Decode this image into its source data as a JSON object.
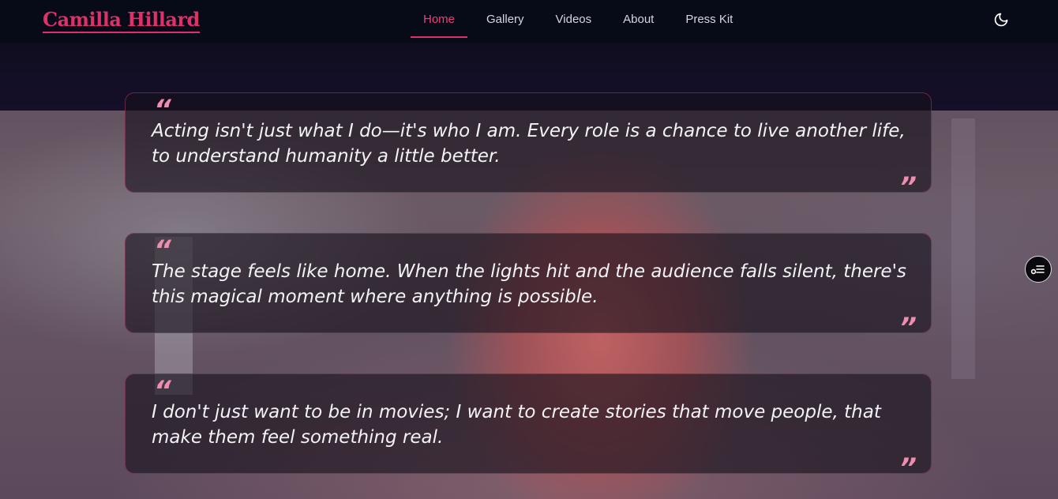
{
  "brand": {
    "name": "Camilla Hillard",
    "color": "#e0306a"
  },
  "nav": {
    "items": [
      {
        "label": "Home",
        "active": true
      },
      {
        "label": "Gallery",
        "active": false
      },
      {
        "label": "Videos",
        "active": false
      },
      {
        "label": "About",
        "active": false
      },
      {
        "label": "Press Kit",
        "active": false
      }
    ],
    "theme_toggle_icon": "moon-icon"
  },
  "quotes": [
    {
      "open_mark": "“",
      "text": "Acting isn't just what I do—it's who I am. Every role is a chance to live another life, to understand humanity a little better.",
      "close_mark": "”"
    },
    {
      "open_mark": "“",
      "text": "The stage feels like home. When the lights hit and the audience falls silent, there's this magical moment where anything is possible.",
      "close_mark": "”"
    },
    {
      "open_mark": "“",
      "text": "I don't just want to be in movies; I want to create stories that move people, that make them feel something real.",
      "close_mark": "”"
    }
  ],
  "side_button": {
    "icon": "accessibility-menu-icon"
  },
  "colors": {
    "accent": "#e0306a",
    "quote_mark": "#ee8db0",
    "nav_bg": "#070b18"
  }
}
